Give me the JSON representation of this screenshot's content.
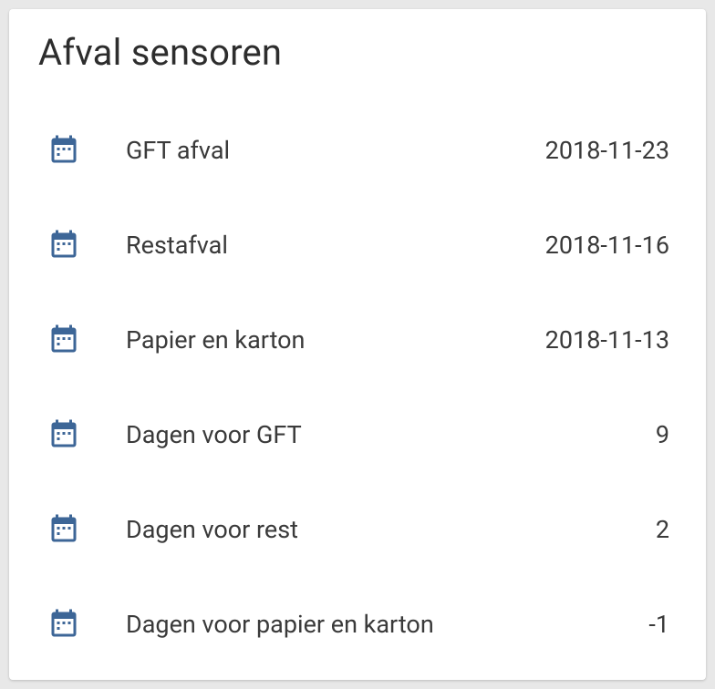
{
  "card": {
    "title": "Afval sensoren"
  },
  "sensors": [
    {
      "icon": "calendar",
      "label": "GFT afval",
      "value": "2018-11-23"
    },
    {
      "icon": "calendar",
      "label": "Restafval",
      "value": "2018-11-16"
    },
    {
      "icon": "calendar",
      "label": "Papier en karton",
      "value": "2018-11-13"
    },
    {
      "icon": "calendar",
      "label": "Dagen voor GFT",
      "value": "9"
    },
    {
      "icon": "calendar",
      "label": "Dagen voor rest",
      "value": "2"
    },
    {
      "icon": "calendar",
      "label": "Dagen voor papier en karton",
      "value": "-1"
    }
  ],
  "colors": {
    "icon": "#3d6697"
  }
}
